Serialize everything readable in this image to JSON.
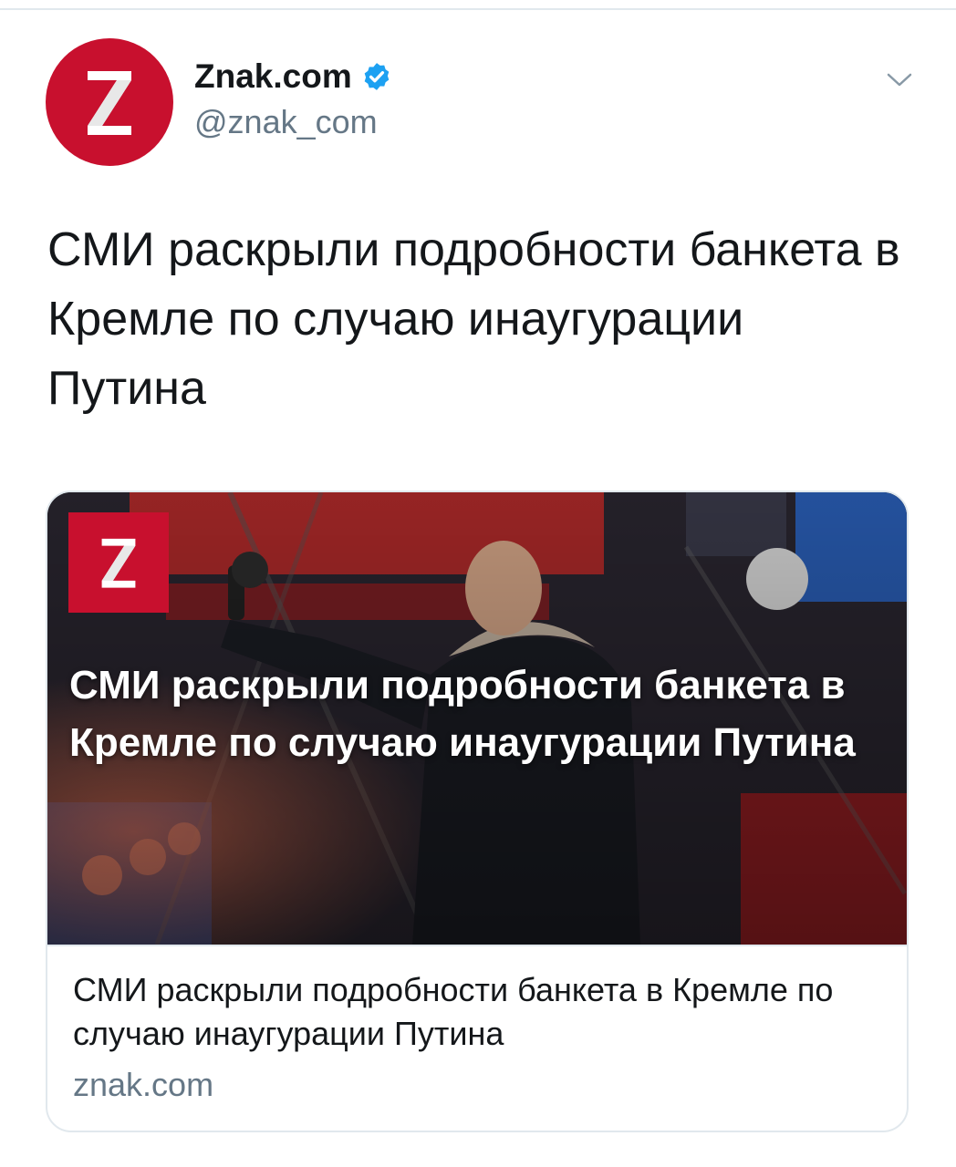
{
  "tweet": {
    "author_name": "Znak.com",
    "author_handle": "@znak_com",
    "text": "СМИ раскрыли подробности банкета в Кремле по случаю инаугурации Путина"
  },
  "card": {
    "image_headline": "СМИ раскрыли подробности банкета в Кремле по случаю инаугурации Путина",
    "title": "СМИ раскрыли подробности банкета в Кремле по случаю инаугурации Путина",
    "domain": "znak.com"
  },
  "icons": {
    "avatar": "znak-logo-icon",
    "verified": "verified-badge-icon",
    "menu": "chevron-down-icon",
    "card_logo": "znak-logo-icon"
  },
  "colors": {
    "brand_red": "#c8102e",
    "verified_blue": "#1da1f2",
    "secondary_text": "#657786",
    "primary_text": "#14171a",
    "border": "#e1e8ed"
  }
}
